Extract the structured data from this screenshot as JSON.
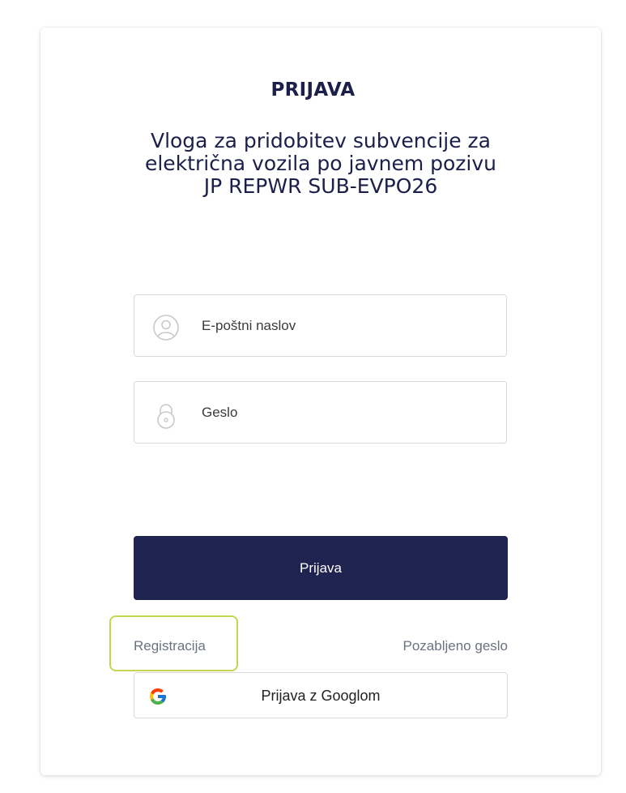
{
  "login": {
    "title": "PRIJAVA",
    "subtitle": "Vloga za pridobitev subvencije za električna vozila po javnem pozivu JP REPWR SUB-EVPO26",
    "email_placeholder": "E-poštni naslov",
    "password_placeholder": "Geslo",
    "submit_label": "Prijava",
    "register_label": "Registracija",
    "forgot_label": "Pozabljeno geslo",
    "google_label": "Prijava z Googlom"
  },
  "icons": {
    "email": "user-icon",
    "password": "lock-icon",
    "google": "google-icon"
  },
  "colors": {
    "primary": "#1f2350",
    "title_text": "#1b1f4a",
    "muted_text": "#6b7280",
    "highlight": "#c7d453",
    "border": "#d9d9d9"
  }
}
